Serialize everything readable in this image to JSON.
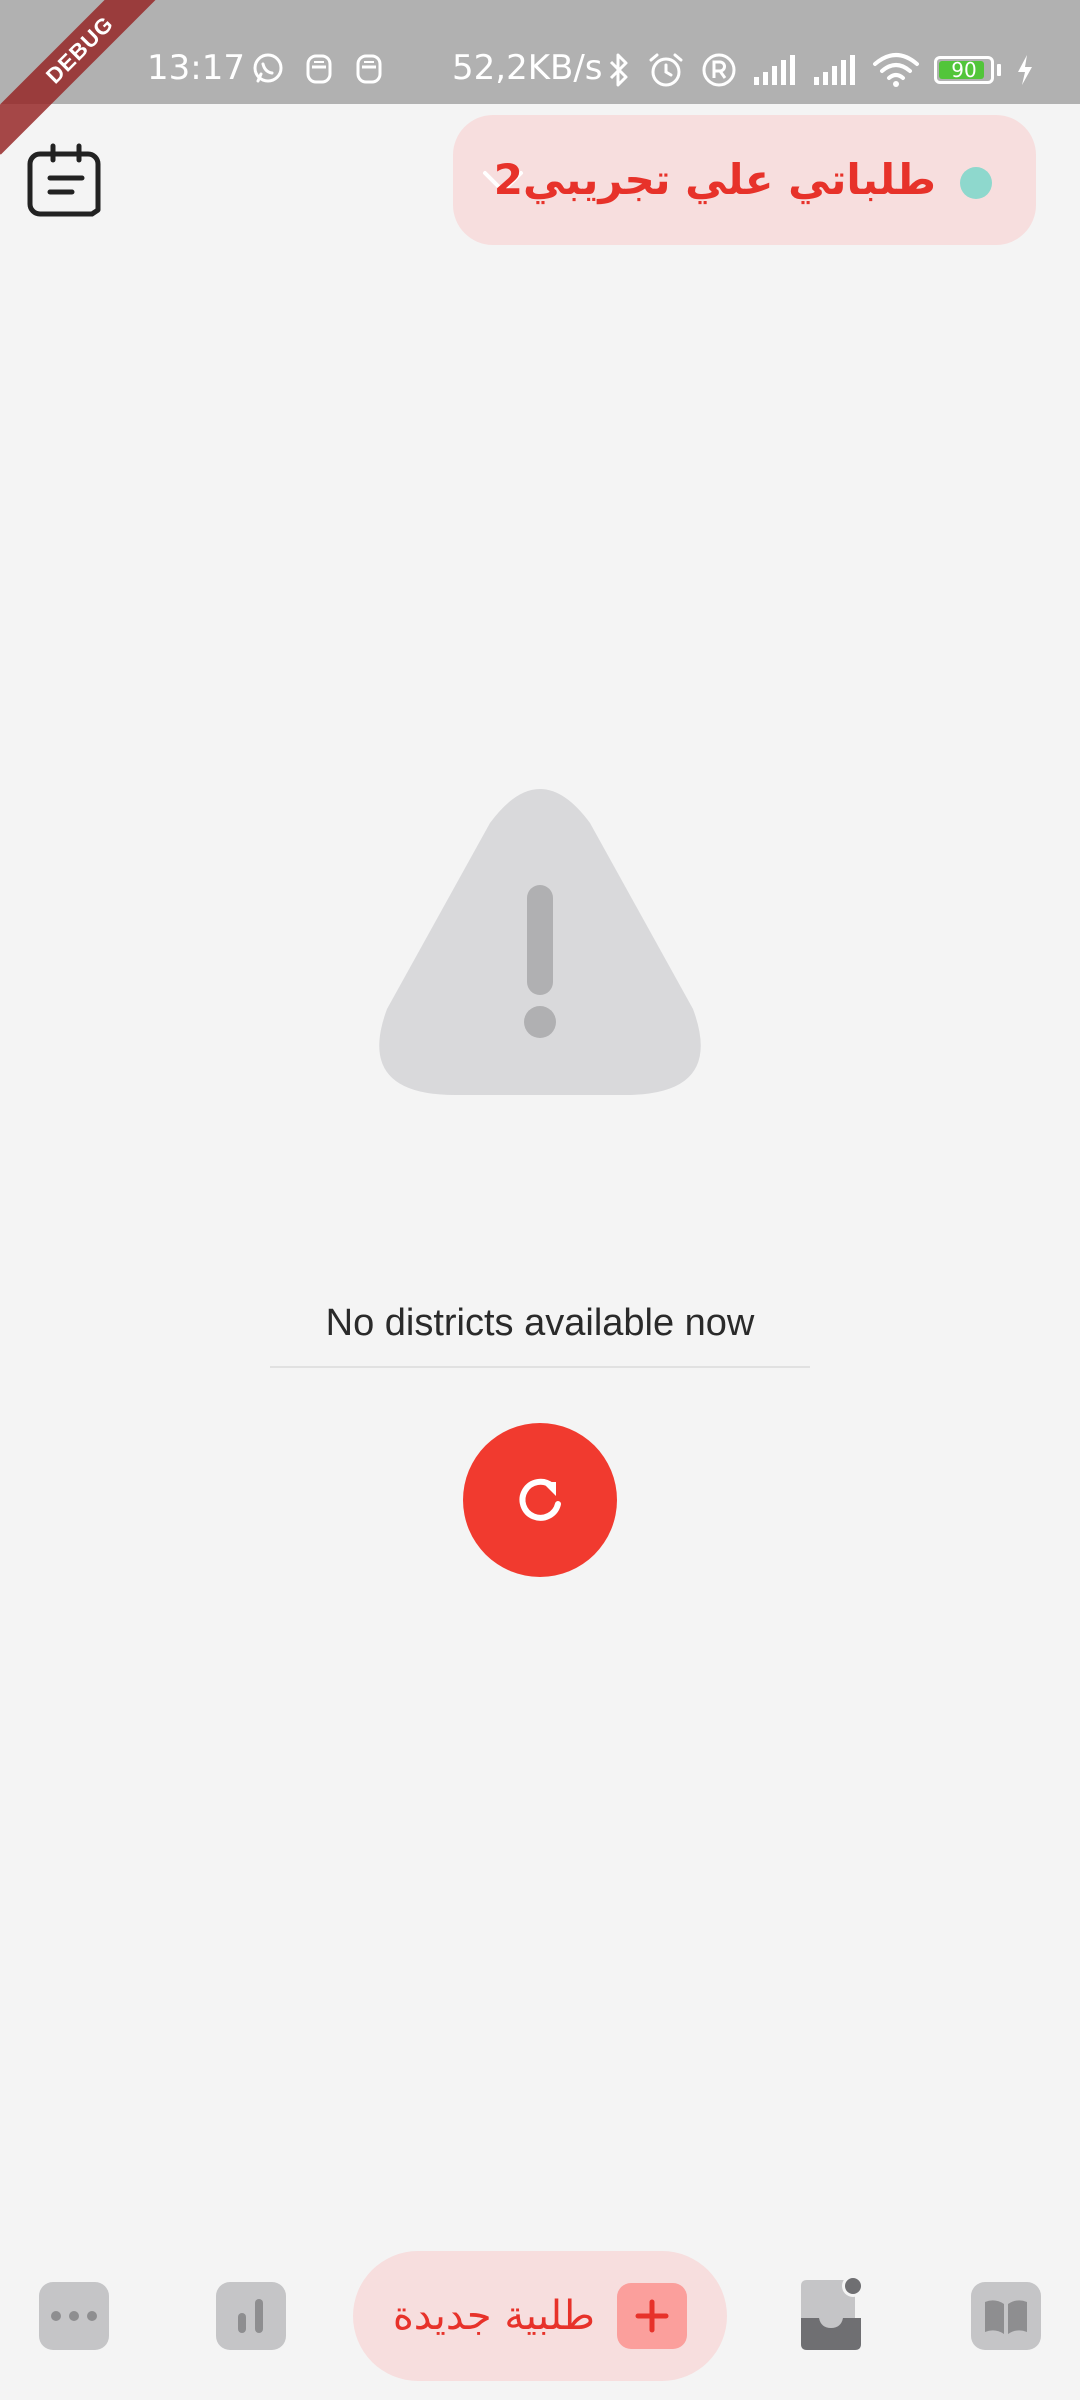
{
  "status_bar": {
    "time": "13:17",
    "network_speed": "52,2KB/s",
    "battery_level": "90",
    "battery_fraction": 0.9,
    "left_icons": [
      "whatsapp-icon",
      "notification-icon",
      "notification-icon"
    ],
    "right_icons": [
      "bluetooth-icon",
      "alarm-icon",
      "registered-icon",
      "signal-icon",
      "signal-icon",
      "wifi-icon",
      "battery-icon",
      "charging-icon"
    ]
  },
  "debug_banner": {
    "label": "DEBUG"
  },
  "header": {
    "title": "طلباتي علي تجريبي2",
    "status_color": "#8ed8cd",
    "icons": {
      "left": "calendar-notes-icon",
      "dropdown": "chevron-down-icon"
    }
  },
  "empty_state": {
    "icon": "warning-triangle-icon",
    "message": "No districts available now",
    "refresh_icon": "refresh-icon"
  },
  "bottom_nav": {
    "items": [
      {
        "icon": "more-dots-icon"
      },
      {
        "icon": "bar-chart-icon"
      },
      {
        "icon": "inbox-icon",
        "has_badge": true
      },
      {
        "icon": "book-icon"
      }
    ],
    "new_order": {
      "label": "طلبية جديدة",
      "icon": "plus-icon"
    }
  },
  "colors": {
    "accent": "#f13a2f",
    "accent_text": "#e7322a",
    "pill_background": "#f7dede",
    "background": "#f4f4f4",
    "status_bar": "#b1b1b1"
  }
}
